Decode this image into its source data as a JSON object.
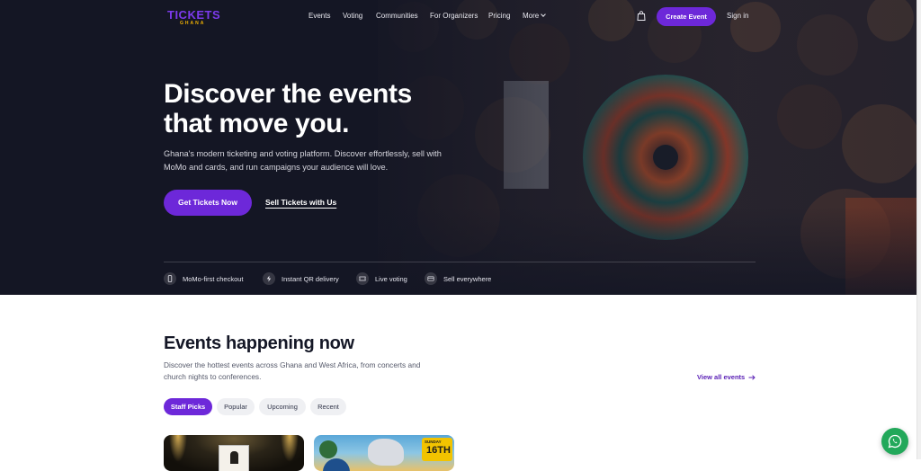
{
  "nav": {
    "logo_main": "TICKETS",
    "logo_sub": "GHANA",
    "links": [
      "Events",
      "Voting",
      "Communities",
      "For Organizers",
      "Pricing",
      "More"
    ],
    "create_event": "Create Event",
    "sign_in": "Sign in"
  },
  "hero": {
    "headline_line1": "Discover the events",
    "headline_line2": "that move you.",
    "subtitle": "Ghana's modern ticketing and voting platform. Discover effortlessly, sell with MoMo and cards, and run campaigns your audience will love.",
    "primary_cta": "Get Tickets Now",
    "secondary_cta": "Sell Tickets with Us",
    "features": [
      {
        "label": "MoMo-first checkout",
        "icon": "phone-icon"
      },
      {
        "label": "Instant QR delivery",
        "icon": "bolt-icon"
      },
      {
        "label": "Live voting",
        "icon": "ticket-icon"
      },
      {
        "label": "Sell everywhere",
        "icon": "card-icon"
      }
    ]
  },
  "events": {
    "title": "Events happening now",
    "subtitle": "Discover the hottest events across Ghana and West Africa, from concerts and church nights to conferences.",
    "view_all": "View all events",
    "filters": [
      "Staff Picks",
      "Popular",
      "Upcoming",
      "Recent"
    ],
    "active_filter": "Staff Picks",
    "card2_badge_day": "SUNDAY",
    "card2_badge_date": "16TH"
  },
  "colors": {
    "brand": "#6d28d9",
    "hero_bg": "#151827",
    "whatsapp": "#22a85a"
  }
}
